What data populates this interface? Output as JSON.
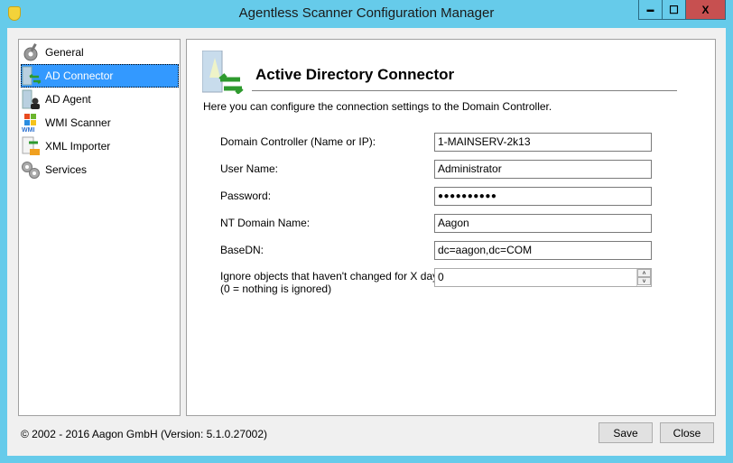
{
  "window": {
    "title": "Agentless Scanner Configuration Manager",
    "minimize": "▬",
    "maximize": "☐",
    "close": "X"
  },
  "sidebar": {
    "items": [
      {
        "label": "General",
        "icon": "gear-wrench-icon"
      },
      {
        "label": "AD Connector",
        "icon": "server-arrows-icon",
        "selected": true
      },
      {
        "label": "AD Agent",
        "icon": "server-agent-icon"
      },
      {
        "label": "WMI Scanner",
        "icon": "windows-wmi-icon"
      },
      {
        "label": "XML Importer",
        "icon": "xml-import-icon"
      },
      {
        "label": "Services",
        "icon": "gears-icon"
      }
    ]
  },
  "main": {
    "title": "Active Directory Connector",
    "description": "Here you can configure the connection settings to the Domain Controller.",
    "fields": [
      {
        "label": "Domain Controller (Name or IP):",
        "value": "1-MAINSERV-2k13"
      },
      {
        "label": "User Name:",
        "value": "Administrator"
      },
      {
        "label": "Password:",
        "value": "●●●●●●●●●●"
      },
      {
        "label": "NT Domain Name:",
        "value": "Aagon"
      },
      {
        "label": "BaseDN:",
        "value": "dc=aagon,dc=COM"
      }
    ],
    "ignore": {
      "label": "Ignore objects that haven't changed for X days:",
      "sublabel": "(0 = nothing is ignored)",
      "value": "0",
      "up": "˄",
      "down": "˅"
    }
  },
  "footer": {
    "copyright": "© 2002 - 2016 Aagon GmbH (Version: 5.1.0.27002)",
    "save": "Save",
    "close": "Close"
  },
  "colors": {
    "titlebar": "#66cbea",
    "selection": "#3399ff",
    "close_button": "#c75050"
  }
}
